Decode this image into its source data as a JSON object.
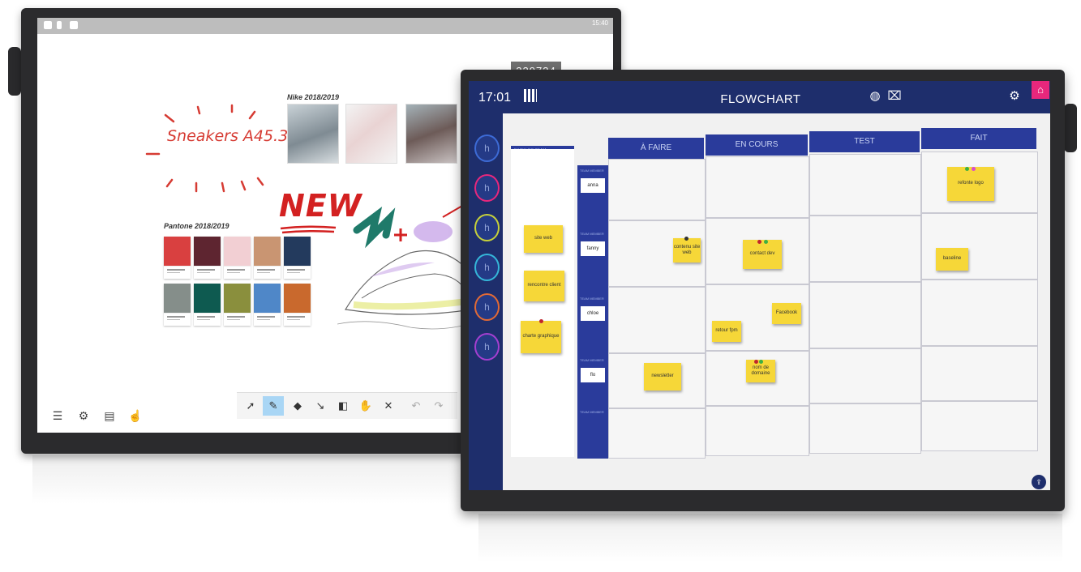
{
  "whiteboard": {
    "code": "229734",
    "clock": "15:40",
    "sneakers_label": "Sneakers A45.3",
    "nike_heading": "Nike 2018/2019",
    "new_label": "NEW",
    "pantone_heading": "Pantone 2018/2019",
    "swatch_colors": [
      "#d94040",
      "#5e2530",
      "#f2cfd3",
      "#c99572",
      "#233a5d",
      "#858e8a",
      "#0e5a50",
      "#8a8f3d",
      "#4f87c8",
      "#c9692d"
    ],
    "left_tools": [
      "menu-icon",
      "settings-icon",
      "notes-icon",
      "pointer-hand-icon"
    ],
    "toolbar": [
      "select-icon",
      "pen-icon",
      "eraser-icon",
      "line-icon",
      "shapes-icon",
      "pan-icon",
      "clear-icon",
      "undo-icon",
      "redo-icon"
    ]
  },
  "flowchart": {
    "time": "17:01",
    "title": "FLOWCHART",
    "backlog_label": "BACKLOG TEAM",
    "team_label": "TEAM MEMBER",
    "columns": [
      "À FAIRE",
      "EN COURS",
      "TEST",
      "FAIT"
    ],
    "members": [
      "anna",
      "fanny",
      "chloe",
      "flo",
      ""
    ],
    "sidebar_colors": [
      "#3d6bd6",
      "#e8277c",
      "#c7d13a",
      "#35b7d9",
      "#e26a35",
      "#a53fd0"
    ],
    "notes": {
      "site_web": "site web",
      "rencontre_client": "rencontre client",
      "charte_graphique": "charte graphique",
      "contenu_site_web": "contenu site web",
      "contact_dev": "contact dev",
      "refonte_logo": "refonte logo",
      "baseline": "baseline",
      "facebook": "Facebook",
      "retour_fpm": "retour fpm",
      "newsletter": "newsletter",
      "nom_de_domaine": "nom de domaine"
    }
  }
}
